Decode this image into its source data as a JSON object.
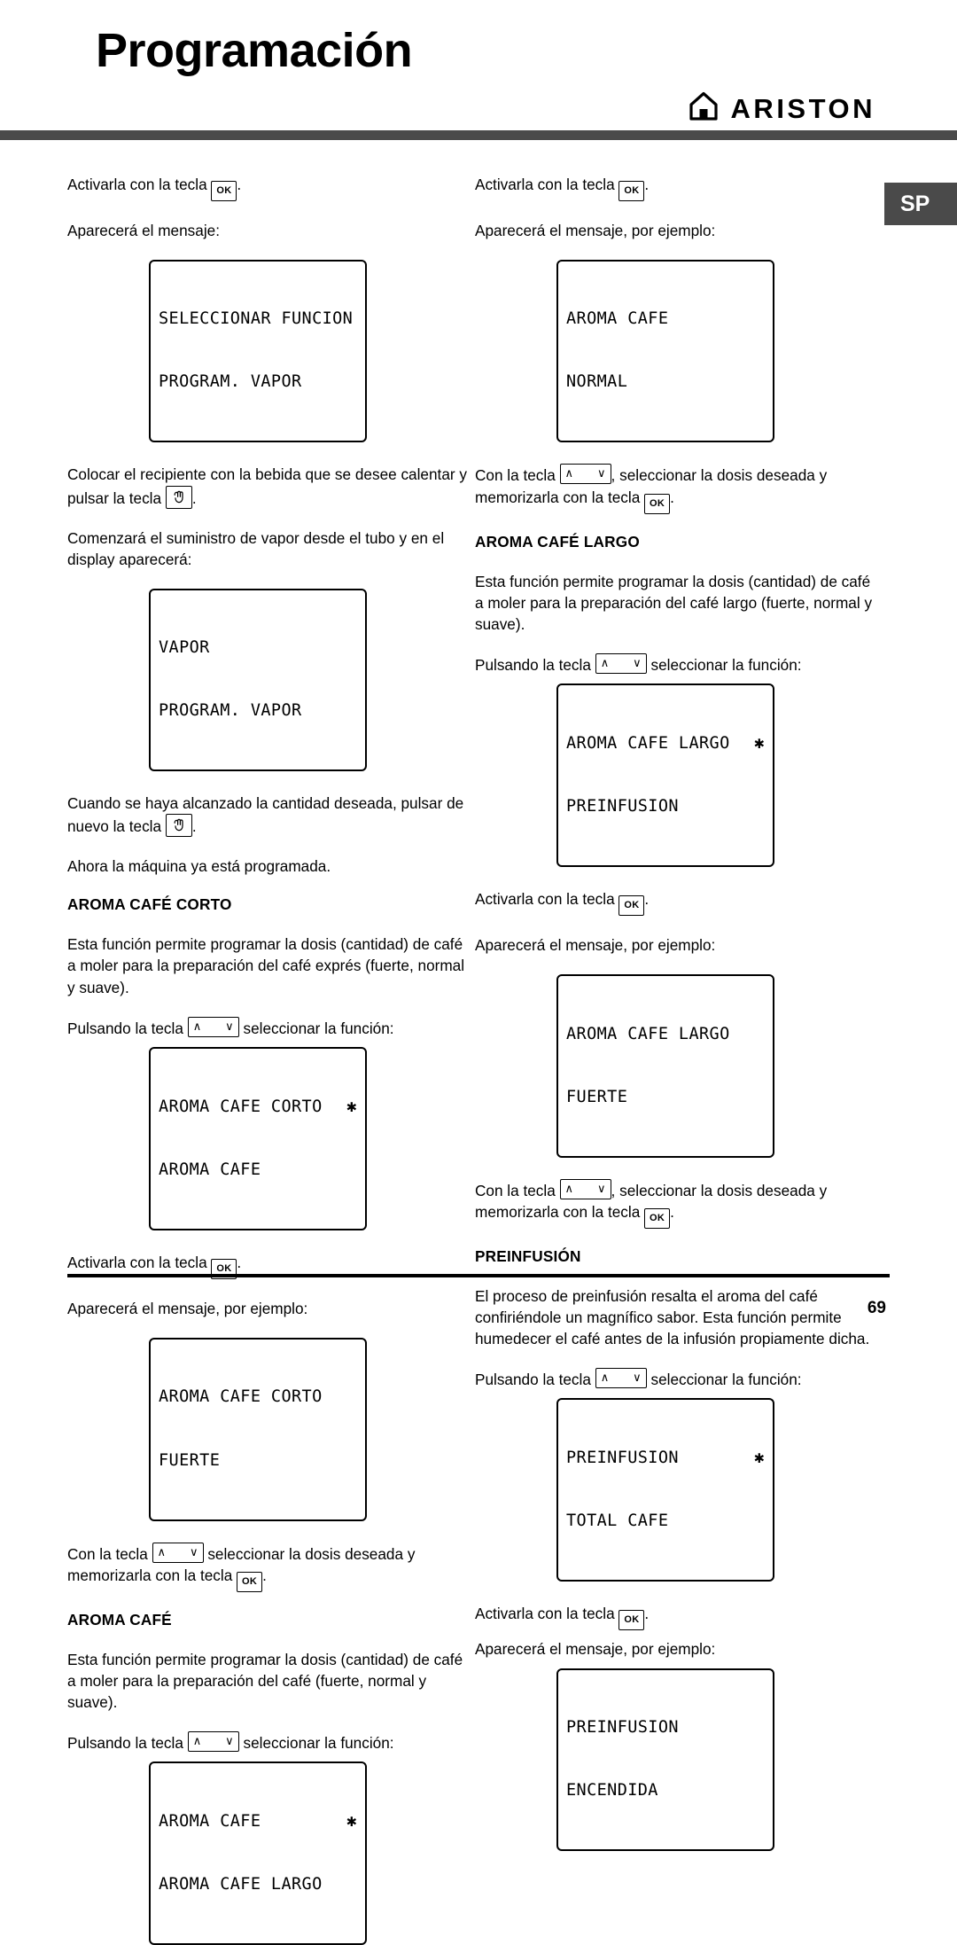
{
  "header": {
    "title": "Programación",
    "brand_name": "ARISTON",
    "brand_icon": "house-icon"
  },
  "lang_tab": {
    "label": "SP"
  },
  "keys": {
    "ok": "OK",
    "up": "∧",
    "down": "∨",
    "steam_icon": "hand-steam-icon"
  },
  "left_column": {
    "p1": "Activarla con la tecla",
    "p1_end": ".",
    "p2": "Aparecerá el mensaje:",
    "lcd1": {
      "line1": "SELECCIONAR FUNCION",
      "line2": "PROGRAM. VAPOR",
      "star": ""
    },
    "p3a": "Colocar el recipiente con la bebida que se desee calentar y pulsar la tecla",
    "p3_end": ".",
    "p4": "Comenzará el suministro de vapor desde el tubo y en el display aparecerá:",
    "lcd2": {
      "line1": "VAPOR",
      "line2": "PROGRAM. VAPOR",
      "star": ""
    },
    "p5a": "Cuando se haya alcanzado la cantidad deseada, pulsar de nuevo la tecla",
    "p5_end": ".",
    "p6": "Ahora la máquina ya está programada.",
    "head1": "AROMA CAFÉ CORTO",
    "p7": "Esta función permite programar la dosis (cantidad) de café a moler para la preparación del café exprés (fuerte, normal y suave).",
    "p8a": "Pulsando la tecla",
    "p8b": "seleccionar la función:",
    "lcd3": {
      "line1": "AROMA CAFE CORTO",
      "line2": "AROMA CAFE",
      "star": "✱"
    },
    "p9": "Activarla con la tecla",
    "p9_end": ".",
    "p10": "Aparecerá el mensaje, por ejemplo:",
    "lcd4": {
      "line1": "AROMA CAFE CORTO",
      "line2": "FUERTE",
      "star": ""
    },
    "p11a": "Con la tecla",
    "p11b": "seleccionar la dosis deseada y memorizarla con la tecla",
    "p11_end": ".",
    "head2": "AROMA CAFÉ",
    "p12": "Esta función permite programar la dosis (cantidad) de café a moler para la preparación del café (fuerte, normal y suave).",
    "p13a": "Pulsando la tecla",
    "p13b": "seleccionar la función:",
    "lcd5": {
      "line1": "AROMA CAFE",
      "line2": "AROMA CAFE LARGO",
      "star": "✱"
    }
  },
  "right_column": {
    "p1": "Activarla con la tecla",
    "p1_end": ".",
    "p2": "Aparecerá el mensaje, por ejemplo:",
    "lcd1": {
      "line1": "AROMA CAFE",
      "line2": "NORMAL",
      "star": ""
    },
    "p3a": "Con la tecla",
    "p3b": ", seleccionar la dosis deseada y memorizarla con la tecla",
    "p3_end": ".",
    "head1": "AROMA CAFÉ LARGO",
    "p4": "Esta función permite programar la dosis (cantidad) de café a moler para la preparación del café largo (fuerte, normal y suave).",
    "p5a": "Pulsando la tecla",
    "p5b": "seleccionar la función:",
    "lcd2": {
      "line1": "AROMA CAFE LARGO",
      "line2": "PREINFUSION",
      "star": "✱"
    },
    "p6": "Activarla con la tecla",
    "p6_end": ".",
    "p7": "Aparecerá el mensaje, por ejemplo:",
    "lcd3": {
      "line1": "AROMA CAFE LARGO",
      "line2": "FUERTE",
      "star": ""
    },
    "p8a": "Con la tecla",
    "p8b": ", seleccionar la dosis deseada y memorizarla con la tecla",
    "p8_end": ".",
    "head2": "PREINFUSIÓN",
    "p9": "El proceso de preinfusión resalta el aroma del café confiriéndole un magnífico sabor. Esta función permite humedecer el café antes de la infusión propiamente dicha.",
    "p10a": "Pulsando la tecla",
    "p10b": "seleccionar la función:",
    "lcd4": {
      "line1": "PREINFUSION",
      "line2": "TOTAL CAFE",
      "star": "✱"
    },
    "p11": "Activarla con la tecla",
    "p11_end": ".",
    "p12": "Aparecerá el mensaje, por ejemplo:",
    "lcd5": {
      "line1": "PREINFUSION",
      "line2": "ENCENDIDA",
      "star": ""
    }
  },
  "footer": {
    "page_number": "69"
  }
}
